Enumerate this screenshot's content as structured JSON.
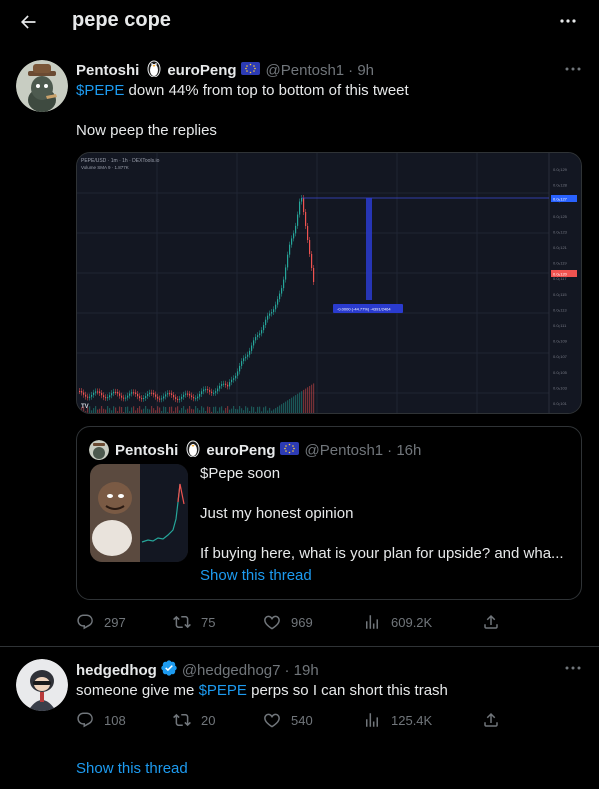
{
  "header": {
    "title": "pepe cope"
  },
  "tweet1": {
    "display_name": "Pentoshi",
    "display_name_suffix": "euroPeng",
    "handle": "@Pentosh1",
    "time": "· 9h",
    "cashtag": "$PEPE",
    "line1_rest": " down 44% from top to bottom of this tweet",
    "line2": "Now peep the replies",
    "image": {
      "title_left": "PEPE/USD · 1m · 1h · DEXTools.io",
      "volume_label": "Volume SMA 9 · 1.877K",
      "measure_label": "-0.0000 (-44.77%) -4391/2464",
      "watermark": "TV",
      "y_ticks": [
        "0.0₀129",
        "0.0₀128",
        "0.0₀127",
        "0.0₀125",
        "0.0₀123",
        "0.0₀121",
        "0.0₀119",
        "0.0₀117",
        "0.0₀115",
        "0.0₀113",
        "0.0₀111",
        "0.0₀109",
        "0.0₀107",
        "0.0₀105",
        "0.0₀103",
        "0.0₀101"
      ],
      "price_top": "0.0₀127",
      "price_current": "0.0₀120"
    },
    "quote": {
      "display_name": "Pentoshi",
      "display_name_suffix": "euroPeng",
      "handle": "@Pentosh1",
      "time": "· 16h",
      "lines": [
        "$Pepe soon",
        "Just my honest opinion",
        "If buying here, what is your plan for upside? and wha..."
      ],
      "show_thread": "Show this thread"
    },
    "actions": {
      "replies": "297",
      "retweets": "75",
      "likes": "969",
      "views": "609.2K"
    }
  },
  "tweet2": {
    "display_name": "hedgedhog",
    "handle": "@hedgedhog7",
    "time": "· 19h",
    "text_before": "someone give me ",
    "cashtag": "$PEPE",
    "text_after": " perps so I can short this trash",
    "actions": {
      "replies": "108",
      "retweets": "20",
      "likes": "540",
      "views": "125.4K"
    },
    "show_thread": "Show this thread"
  },
  "icons": {
    "back": "arrow-left-icon",
    "more": "more-dots-icon",
    "reply": "reply-bubble-icon",
    "retweet": "retweet-icon",
    "like": "heart-icon",
    "views": "views-bar-icon",
    "share": "share-icon",
    "verified": "verified-badge-icon",
    "eu_flag": "eu-flag-icon",
    "penguin": "penguin-emoji-icon"
  },
  "colors": {
    "accent": "#1d9bf0",
    "muted": "#71767b",
    "text": "#e7e9ea",
    "border": "#2f3336",
    "background": "#000000"
  }
}
